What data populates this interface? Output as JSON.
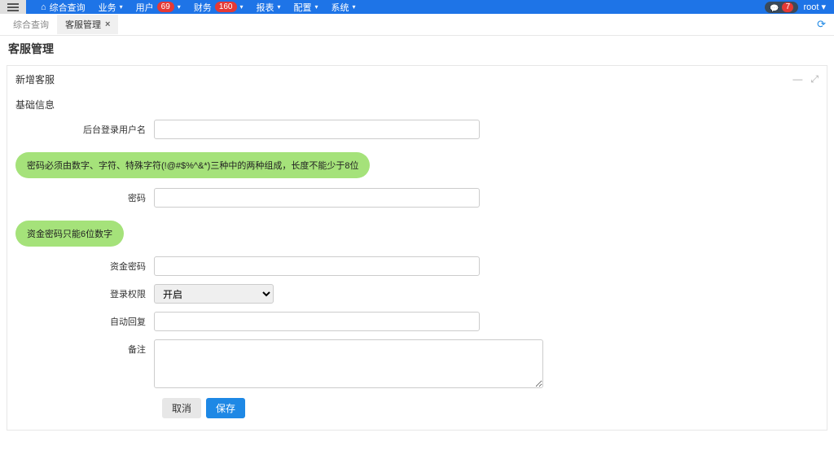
{
  "navbar": {
    "items": [
      {
        "icon": "home",
        "label": "综合查询"
      },
      {
        "label": "业务",
        "caret": true
      },
      {
        "label": "用户",
        "badge": "69",
        "caret": true
      },
      {
        "label": "财务",
        "badge": "160",
        "caret": true
      },
      {
        "label": "报表",
        "caret": true
      },
      {
        "label": "配置",
        "caret": true
      },
      {
        "label": "系统",
        "caret": true
      }
    ],
    "chat_badge": "7",
    "user": "root"
  },
  "tabs": {
    "items": [
      {
        "label": "综合查询",
        "closable": false
      },
      {
        "label": "客服管理",
        "closable": true,
        "active": true
      }
    ]
  },
  "page": {
    "title": "客服管理",
    "panel_title": "新增客服",
    "section_title": "基础信息"
  },
  "form": {
    "username_label": "后台登录用户名",
    "password_tip": "密码必须由数字、字符、特殊字符(!@#$%^&*)三种中的两种组成，长度不能少于8位",
    "password_label": "密码",
    "fund_tip": "资金密码只能6位数字",
    "fund_label": "资金密码",
    "login_perm_label": "登录权限",
    "login_perm_option": "开启",
    "auto_reply_label": "自动回复",
    "remark_label": "备注"
  },
  "buttons": {
    "cancel": "取消",
    "save": "保存"
  }
}
